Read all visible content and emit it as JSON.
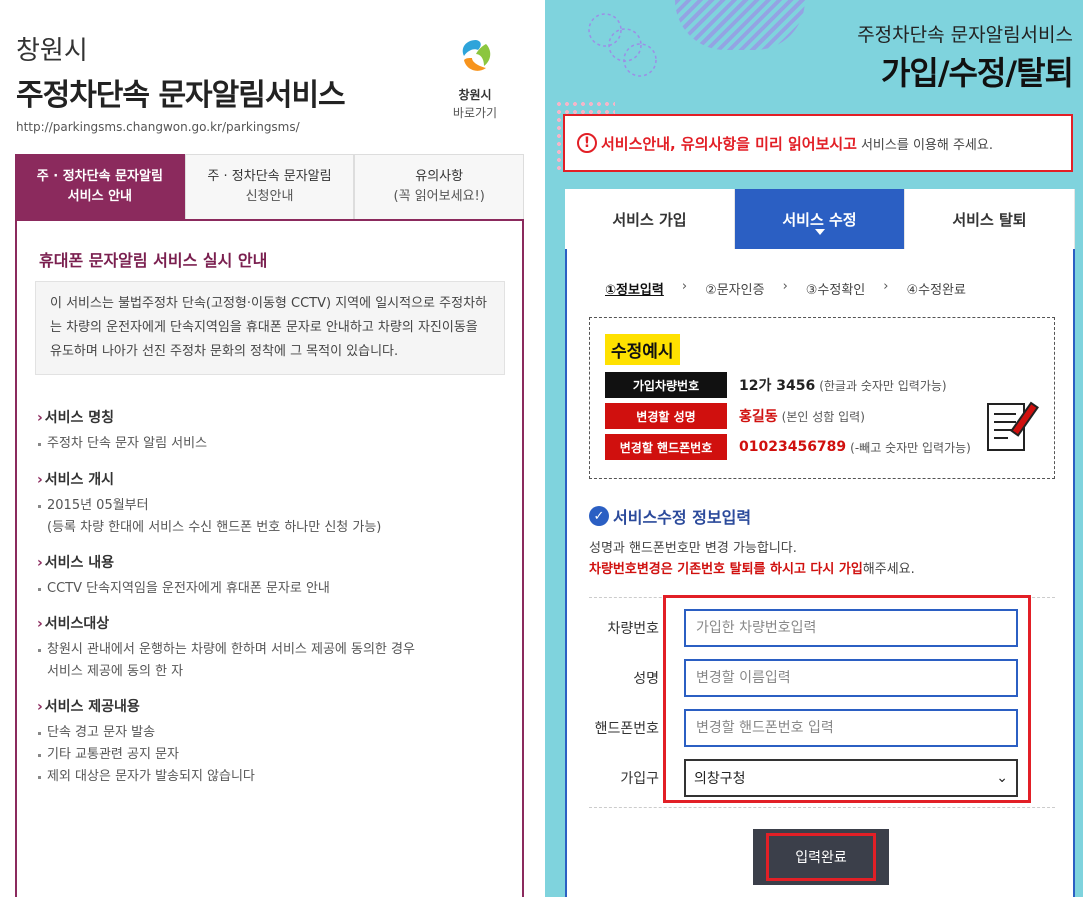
{
  "left": {
    "city": "창원시",
    "title": "주정차단속 문자알림서비스",
    "url": "http://parkingsms.changwon.go.kr/parkingsms/",
    "logo_label": "창원시",
    "logo_sub": "바로가기",
    "tabs": [
      {
        "line1": "주 · 정차단속 문자알림",
        "line2": "서비스 안내",
        "active": true
      },
      {
        "line1": "주 · 정차단속 문자알림",
        "line2": "신청안내",
        "active": false
      },
      {
        "line1": "유의사항",
        "line2": "(꼭 읽어보세요!)",
        "active": false
      }
    ],
    "heading": "휴대폰 문자알림 서비스 실시 안내",
    "intro": "이 서비스는 불법주정차 단속(고정형·이동형 CCTV) 지역에 일시적으로 주정차하는 차량의 운전자에게 단속지역임을 휴대폰 문자로 안내하고 차량의 자진이동을 유도하며 나아가 선진 주정차 문화의 정착에 그 목적이 있습니다.",
    "sections": [
      {
        "title": "서비스 명칭",
        "items": [
          "주정차 단속 문자 알림 서비스"
        ]
      },
      {
        "title": "서비스 개시",
        "items": [
          "2015년 05월부터",
          "(등록 차량 한대에 서비스 수신 핸드폰 번호 하나만 신청 가능)"
        ]
      },
      {
        "title": "서비스 내용",
        "items": [
          "CCTV 단속지역임을 운전자에게 휴대폰 문자로 안내"
        ]
      },
      {
        "title": "서비스대상",
        "items": [
          "창원시 관내에서 운행하는 차량에 한하며 서비스 제공에 동의한 경우",
          "서비스 제공에 동의 한 자"
        ]
      },
      {
        "title": "서비스 제공내용",
        "items": [
          "단속 경고 문자 발송",
          "기타 교통관련 공지 문자",
          "제외 대상은 문자가 발송되지 않습니다"
        ]
      }
    ]
  },
  "right": {
    "subtitle": "주정차단속 문자알림서비스",
    "title": "가입/수정/탈퇴",
    "notice_icon": "!",
    "notice_strong": "서비스안내, 유의사항을 미리 읽어보시고",
    "notice_rest": "서비스를 이용해 주세요.",
    "tabs": [
      "서비스 가입",
      "서비스 수정",
      "서비스 탈퇴"
    ],
    "steps": [
      "①정보입력",
      "②문자인증",
      "③수정확인",
      "④수정완료"
    ],
    "step_sep": "›",
    "example": {
      "title": "수정예시",
      "rows": [
        {
          "label": "가입차량번호",
          "value": "12가 3456",
          "note": "(한글과 숫자만 입력가능)"
        },
        {
          "label": "변경할 성명",
          "value": "홍길동",
          "note": "(본인 성함 입력)"
        },
        {
          "label": "변경할 핸드폰번호",
          "value": "01023456789",
          "note": "(-빼고 숫자만 입력가능)"
        }
      ]
    },
    "form_heading": "서비스수정 정보입력",
    "form_note1": "성명과 핸드폰번호만 변경 가능합니다.",
    "form_note2_red": "차량번호변경은 기존번호 탈퇴를 하시고 다시 가입",
    "form_note2_rest": "해주세요.",
    "fields": [
      {
        "label": "차량번호",
        "placeholder": "가입한 차량번호입력"
      },
      {
        "label": "성명",
        "placeholder": "변경할 이름입력"
      },
      {
        "label": "핸드폰번호",
        "placeholder": "변경할 핸드폰번호 입력"
      }
    ],
    "district_label": "가입구",
    "district_value": "의창구청",
    "submit": "입력완료"
  },
  "colors": {
    "left_accent": "#8b2a5d",
    "right_bg": "#7fd3dd",
    "blue": "#2b5fc3",
    "red": "#e21f26"
  }
}
